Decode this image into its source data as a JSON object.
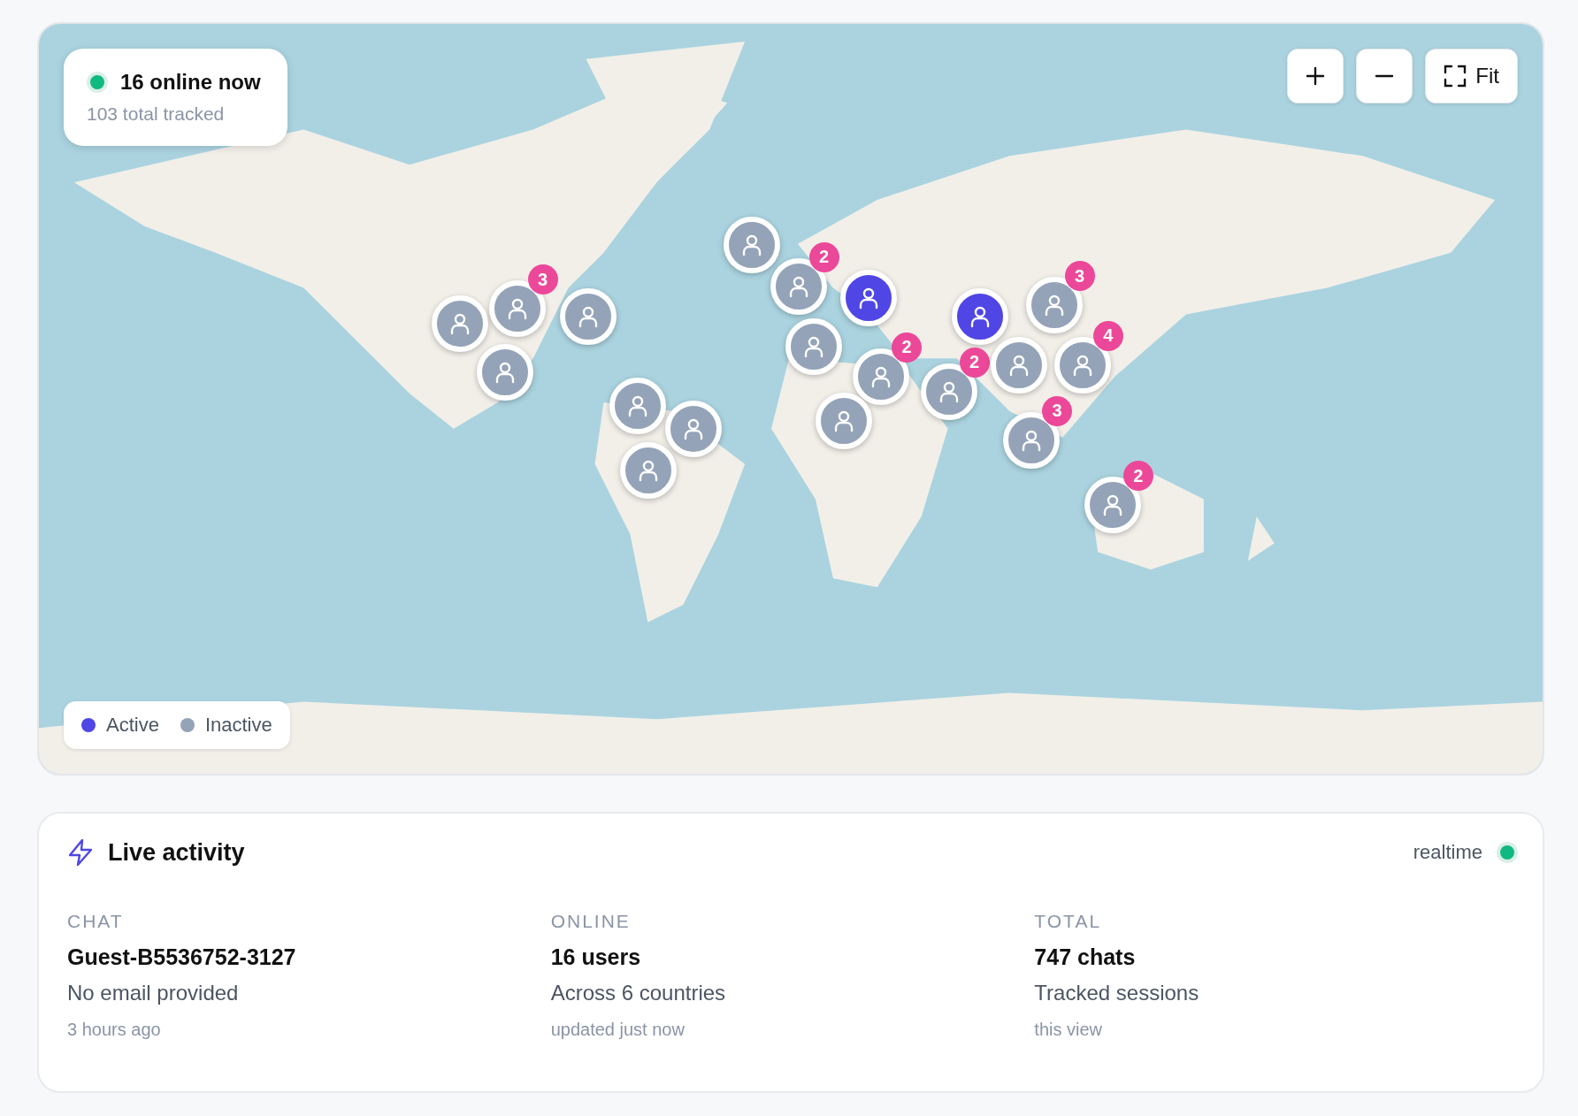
{
  "map": {
    "kind": "picture",
    "status": {
      "online": true,
      "headline": "16 online now",
      "subline": "103 total tracked"
    },
    "controls": [
      {
        "kind": "zoom_in"
      },
      {
        "kind": "zoom_out"
      },
      {
        "kind": "fit",
        "label": "Fit"
      }
    ],
    "markers": [
      {
        "active": false
      },
      {
        "active": false,
        "count": "3"
      },
      {
        "active": false
      },
      {
        "active": false
      },
      {
        "active": false
      },
      {
        "active": false
      },
      {
        "active": false
      },
      {
        "active": false
      },
      {
        "active": false,
        "count": "2"
      },
      {
        "active": true
      },
      {
        "active": false
      },
      {
        "active": false,
        "count": "2"
      },
      {
        "active": false
      },
      {
        "active": true
      },
      {
        "active": false,
        "count": "2"
      },
      {
        "active": false
      },
      {
        "active": false,
        "count": "3"
      },
      {
        "active": false,
        "count": "4"
      },
      {
        "active": false,
        "count": "3"
      },
      {
        "active": false,
        "count": "2"
      }
    ],
    "legend": [
      {
        "label": "Active",
        "color": "#4f46e5"
      },
      {
        "label": "Inactive",
        "color": "#94a3b8"
      }
    ]
  },
  "activity": {
    "title": "Live activity",
    "live_label": "realtime",
    "live": true,
    "stats": [
      {
        "heading": "CHAT",
        "value": "Guest-B5536752-3127",
        "detail": "No email provided",
        "note": "3 hours ago"
      },
      {
        "heading": "ONLINE",
        "value": "16 users",
        "detail": "Across 6 countries",
        "note": "updated just now"
      },
      {
        "heading": "TOTAL",
        "value": "747 chats",
        "detail": "Tracked sessions",
        "note": "this view"
      }
    ]
  }
}
